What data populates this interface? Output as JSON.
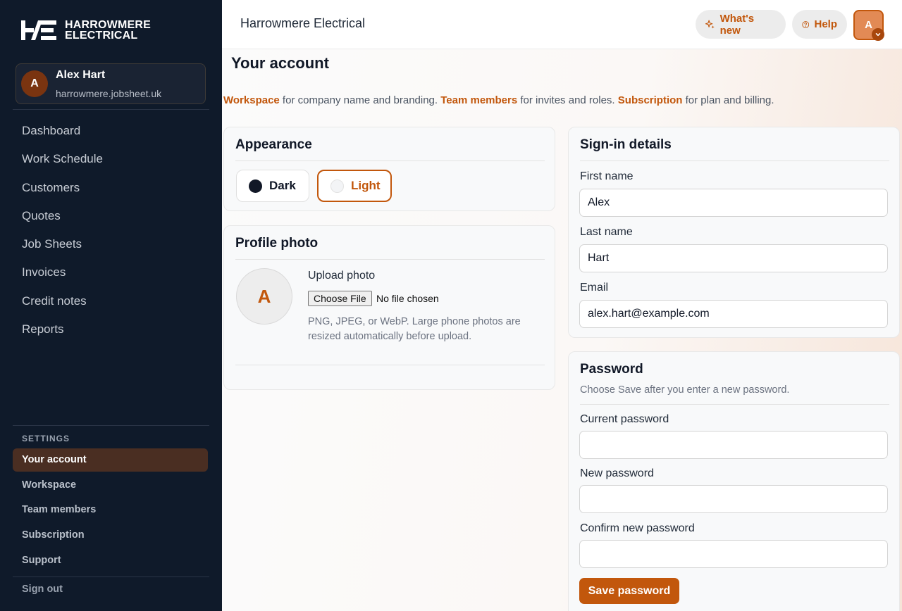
{
  "brand": {
    "logo_line1": "HARROWMERE",
    "logo_line2": "ELECTRICAL",
    "title": "Harrowmere Electrical",
    "accent_color": "#c2570c"
  },
  "user": {
    "initial": "A",
    "name": "Alex Hart",
    "domain": "harrowmere.jobsheet.uk"
  },
  "nav": {
    "items": [
      "Dashboard",
      "Work Schedule",
      "Customers",
      "Quotes",
      "Job Sheets",
      "Invoices",
      "Credit notes",
      "Reports"
    ]
  },
  "settings": {
    "label": "SETTINGS",
    "items": [
      "Your account",
      "Workspace",
      "Team members",
      "Subscription",
      "Support"
    ],
    "active": "Your account",
    "signout": "Sign out"
  },
  "topbar": {
    "whats_new": "What's new",
    "help": "Help",
    "avatar_initial": "A"
  },
  "page": {
    "title": "Your account",
    "intro": {
      "link1": "Workspace",
      "text1": " for company name and branding. ",
      "link2": "Team members",
      "text2": " for invites and roles. ",
      "link3": "Subscription",
      "text3": " for plan and billing."
    }
  },
  "appearance": {
    "title": "Appearance",
    "dark": "Dark",
    "light": "Light",
    "selected": "Light"
  },
  "profile_photo": {
    "title": "Profile photo",
    "initial": "A",
    "upload_label": "Upload photo",
    "file_button": "Choose File",
    "file_status": "No file chosen",
    "hint": "PNG, JPEG, or WebP. Large phone photos are resized automatically before upload."
  },
  "signin": {
    "title": "Sign-in details",
    "first_name_label": "First name",
    "first_name": "Alex",
    "last_name_label": "Last name",
    "last_name": "Hart",
    "email_label": "Email",
    "email": "alex.hart@example.com"
  },
  "password": {
    "title": "Password",
    "subtitle": "Choose Save after you enter a new password.",
    "current_label": "Current password",
    "current": "",
    "new_label": "New password",
    "new": "",
    "confirm_label": "Confirm new password",
    "confirm": "",
    "save": "Save password"
  }
}
